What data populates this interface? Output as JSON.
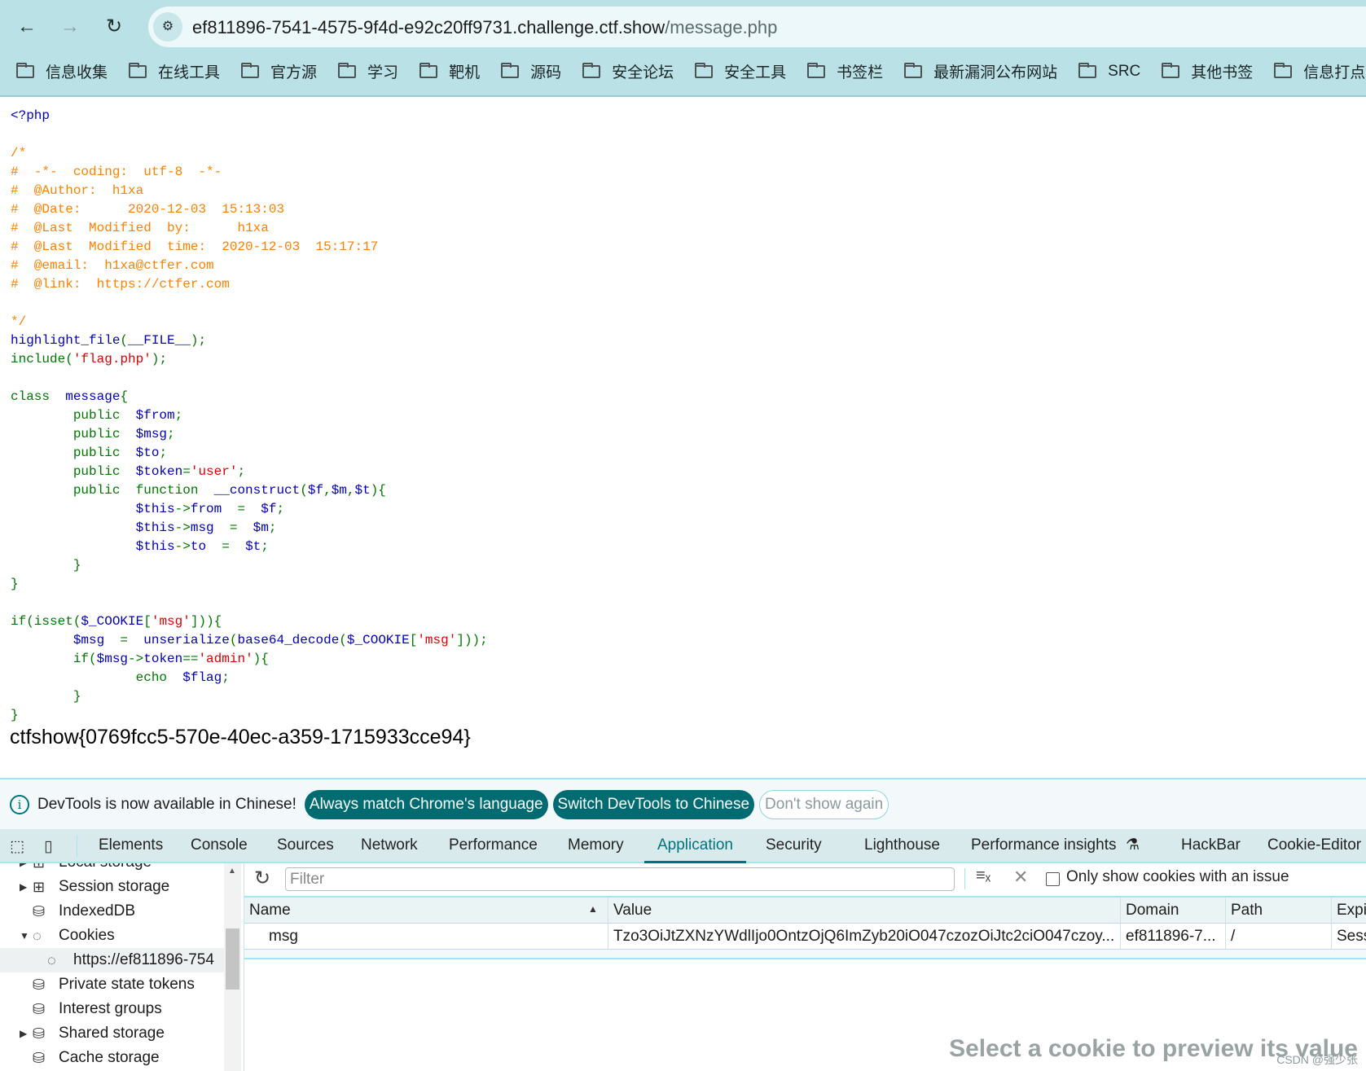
{
  "browser": {
    "url_host": "ef811896-7541-4575-9f4d-e92c20ff9731.challenge.ctf.show",
    "url_path": "/message.php",
    "bookmarks": [
      "信息收集",
      "在线工具",
      "官方源",
      "学习",
      "靶机",
      "源码",
      "安全论坛",
      "安全工具",
      "书签栏",
      "最新漏洞公布网站",
      "SRC",
      "其他书签",
      "信息打点"
    ]
  },
  "theme": {
    "default": "#0000BB",
    "keyword": "#007700",
    "string": "#DD0000",
    "comment": "#FF8000",
    "accent": "#00747c"
  },
  "code": [
    [
      [
        "<?php",
        "default"
      ]
    ],
    [],
    [
      [
        "/*",
        "comment"
      ]
    ],
    [
      [
        "#  -*-  coding:  utf-8  -*-",
        "comment"
      ]
    ],
    [
      [
        "#  @Author:  h1xa",
        "comment"
      ]
    ],
    [
      [
        "#  @Date:      2020-12-03  15:13:03",
        "comment"
      ]
    ],
    [
      [
        "#  @Last  Modified  by:      h1xa",
        "comment"
      ]
    ],
    [
      [
        "#  @Last  Modified  time:  2020-12-03  15:17:17",
        "comment"
      ]
    ],
    [
      [
        "#  @email:  h1xa@ctfer.com",
        "comment"
      ]
    ],
    [
      [
        "#  @link:  https://ctfer.com",
        "comment"
      ]
    ],
    [],
    [
      [
        "*/",
        "comment"
      ]
    ],
    [
      [
        "highlight_file",
        "default"
      ],
      [
        "(",
        "keyword"
      ],
      [
        "__FILE__",
        "default"
      ],
      [
        ");",
        "keyword"
      ]
    ],
    [
      [
        "include",
        "keyword"
      ],
      [
        "(",
        "keyword"
      ],
      [
        "'flag.php'",
        "string"
      ],
      [
        ");",
        "keyword"
      ]
    ],
    [],
    [
      [
        "class  ",
        "keyword"
      ],
      [
        "message",
        "default"
      ],
      [
        "{",
        "keyword"
      ]
    ],
    [
      [
        "        public  ",
        "keyword"
      ],
      [
        "$from",
        "default"
      ],
      [
        ";",
        "keyword"
      ]
    ],
    [
      [
        "        public  ",
        "keyword"
      ],
      [
        "$msg",
        "default"
      ],
      [
        ";",
        "keyword"
      ]
    ],
    [
      [
        "        public  ",
        "keyword"
      ],
      [
        "$to",
        "default"
      ],
      [
        ";",
        "keyword"
      ]
    ],
    [
      [
        "        public  ",
        "keyword"
      ],
      [
        "$token",
        "default"
      ],
      [
        "=",
        "keyword"
      ],
      [
        "'user'",
        "string"
      ],
      [
        ";",
        "keyword"
      ]
    ],
    [
      [
        "        public  function  ",
        "keyword"
      ],
      [
        "__construct",
        "default"
      ],
      [
        "(",
        "keyword"
      ],
      [
        "$f",
        "default"
      ],
      [
        ",",
        "keyword"
      ],
      [
        "$m",
        "default"
      ],
      [
        ",",
        "keyword"
      ],
      [
        "$t",
        "default"
      ],
      [
        "){",
        "keyword"
      ]
    ],
    [
      [
        "                ",
        "keyword"
      ],
      [
        "$this",
        "default"
      ],
      [
        "->",
        "keyword"
      ],
      [
        "from  ",
        "default"
      ],
      [
        "=  ",
        "keyword"
      ],
      [
        "$f",
        "default"
      ],
      [
        ";",
        "keyword"
      ]
    ],
    [
      [
        "                ",
        "keyword"
      ],
      [
        "$this",
        "default"
      ],
      [
        "->",
        "keyword"
      ],
      [
        "msg  ",
        "default"
      ],
      [
        "=  ",
        "keyword"
      ],
      [
        "$m",
        "default"
      ],
      [
        ";",
        "keyword"
      ]
    ],
    [
      [
        "                ",
        "keyword"
      ],
      [
        "$this",
        "default"
      ],
      [
        "->",
        "keyword"
      ],
      [
        "to  ",
        "default"
      ],
      [
        "=  ",
        "keyword"
      ],
      [
        "$t",
        "default"
      ],
      [
        ";",
        "keyword"
      ]
    ],
    [
      [
        "        }",
        "keyword"
      ]
    ],
    [
      [
        "}",
        "keyword"
      ]
    ],
    [],
    [
      [
        "if(isset(",
        "keyword"
      ],
      [
        "$_COOKIE",
        "default"
      ],
      [
        "[",
        "keyword"
      ],
      [
        "'msg'",
        "string"
      ],
      [
        "])){",
        "keyword"
      ]
    ],
    [
      [
        "        ",
        "keyword"
      ],
      [
        "$msg  ",
        "default"
      ],
      [
        "=  ",
        "keyword"
      ],
      [
        "unserialize",
        "default"
      ],
      [
        "(",
        "keyword"
      ],
      [
        "base64_decode",
        "default"
      ],
      [
        "(",
        "keyword"
      ],
      [
        "$_COOKIE",
        "default"
      ],
      [
        "[",
        "keyword"
      ],
      [
        "'msg'",
        "string"
      ],
      [
        "]));",
        "keyword"
      ]
    ],
    [
      [
        "        if(",
        "keyword"
      ],
      [
        "$msg",
        "default"
      ],
      [
        "->",
        "keyword"
      ],
      [
        "token",
        "default"
      ],
      [
        "==",
        "keyword"
      ],
      [
        "'admin'",
        "string"
      ],
      [
        "){",
        "keyword"
      ]
    ],
    [
      [
        "                echo  ",
        "keyword"
      ],
      [
        "$flag",
        "default"
      ],
      [
        ";",
        "keyword"
      ]
    ],
    [
      [
        "        }",
        "keyword"
      ]
    ],
    [
      [
        "}",
        "keyword"
      ]
    ]
  ],
  "flag_output": "ctfshow{0769fcc5-570e-40ec-a359-1715933cce94}",
  "banner": {
    "text": "DevTools is now available in Chinese!",
    "btn_match": "Always match Chrome's language",
    "btn_switch": "Switch DevTools to Chinese",
    "btn_dismiss": "Don't show again"
  },
  "devtools": {
    "tabs": [
      "Elements",
      "Console",
      "Sources",
      "Network",
      "Performance",
      "Memory",
      "Application",
      "Security",
      "Lighthouse",
      "Performance insights",
      "HackBar",
      "Cookie-Editor"
    ],
    "active_tab": "Application",
    "sidebar": [
      "Local storage",
      "Session storage",
      "IndexedDB",
      "Cookies",
      "https://ef811896-754",
      "Private state tokens",
      "Interest groups",
      "Shared storage",
      "Cache storage"
    ],
    "filter_placeholder": "Filter",
    "only_issue_label": "Only show cookies with an issue",
    "columns": [
      "Name",
      "Value",
      "Domain",
      "Path",
      "Expi"
    ],
    "rows": [
      [
        "msg",
        "Tzo3OiJtZXNzYWdlIjo0OntzOjQ6ImZyb20iO047czozOiJtc2ciO047czoy...",
        "ef811896-7...",
        "/",
        "Sess"
      ]
    ],
    "preview_hint": "Select a cookie to preview its value"
  },
  "watermark": "CSDN @强少张"
}
